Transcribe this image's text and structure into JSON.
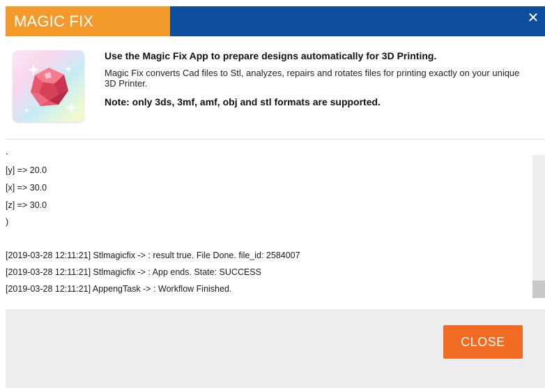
{
  "dialog": {
    "title": "MAGIC FIX",
    "close_symbol": "✕",
    "colors": {
      "title_orange": "#f39a2b",
      "title_blue": "#0d4f9d",
      "button_orange": "#f26b22"
    }
  },
  "app": {
    "icon": "magic-gem-icon",
    "headline": "Use the Magic Fix App to prepare designs automatically for 3D Printing.",
    "description": "Magic Fix converts Cad files to Stl, analyzes, repairs and rotates files for printing exactly on your unique 3D Printer.",
    "note": "Note: only 3ds, 3mf, amf, obj and stl formats are supported."
  },
  "log": {
    "lines": [
      "`",
      "[y] => 20.0",
      "[x] => 30.0",
      "[z] => 30.0",
      ")",
      "[2019-03-28 12:11:21] Stlmagicfix -> : result true. File Done. file_id: 2584007",
      "[2019-03-28 12:11:21] Stlmagicfix -> : App ends. State: SUCCESS",
      "[2019-03-28 12:11:21] AppengTask -> : Workflow Finished."
    ]
  },
  "footer": {
    "close_label": "CLOSE"
  }
}
